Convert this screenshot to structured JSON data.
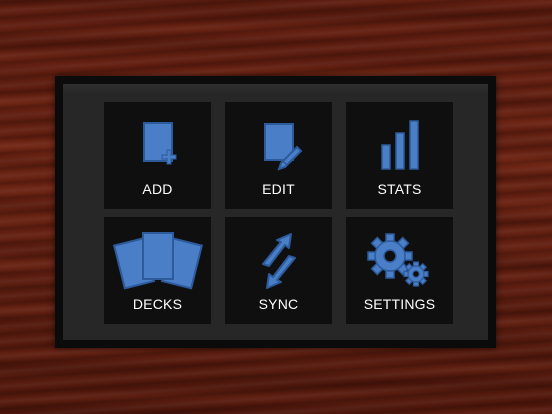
{
  "colors": {
    "icon_fill": "#4a7fc8",
    "icon_stroke": "#2c5a9a",
    "tile_bg": "#0f0f0f",
    "panel_bg": "#272727",
    "label": "#ffffff"
  },
  "menu": {
    "tiles": [
      {
        "label": "ADD",
        "icon": "add-card-icon"
      },
      {
        "label": "EDIT",
        "icon": "edit-card-icon"
      },
      {
        "label": "STATS",
        "icon": "bar-chart-icon"
      },
      {
        "label": "DECKS",
        "icon": "decks-icon"
      },
      {
        "label": "SYNC",
        "icon": "sync-arrows-icon"
      },
      {
        "label": "SETTINGS",
        "icon": "gears-icon"
      }
    ]
  }
}
